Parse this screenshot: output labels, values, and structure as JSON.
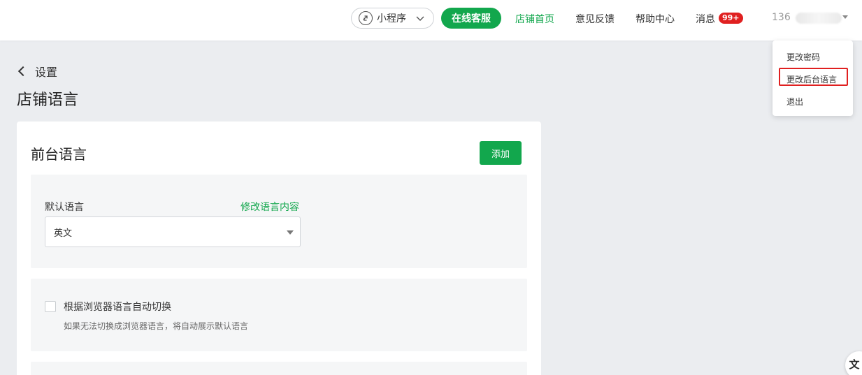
{
  "topbar": {
    "mini_program": "小程序",
    "online_service": "在线客服",
    "store_home": "店铺首页",
    "feedback": "意见反馈",
    "help_center": "帮助中心",
    "messages": "消息",
    "messages_badge": "99+",
    "user": "136"
  },
  "user_menu": {
    "change_password": "更改密码",
    "change_admin_language": "更改后台语言",
    "logout": "退出"
  },
  "breadcrumb": {
    "back_label": "设置"
  },
  "page": {
    "title": "店铺语言"
  },
  "frontend_language": {
    "title": "前台语言",
    "add_button": "添加",
    "default_label": "默认语言",
    "edit_link": "修改语言内容",
    "default_value": "英文",
    "auto_switch_label": "根据浏览器语言自动切换",
    "auto_switch_hint": "如果无法切换成浏览器语言，将自动展示默认语言",
    "auto_switch_checked": false
  },
  "floating": {
    "icon_text": "文"
  },
  "colors": {
    "accent": "#12a74d",
    "badge": "#e02020",
    "highlight": "#e02020",
    "background": "#ebedf0"
  }
}
